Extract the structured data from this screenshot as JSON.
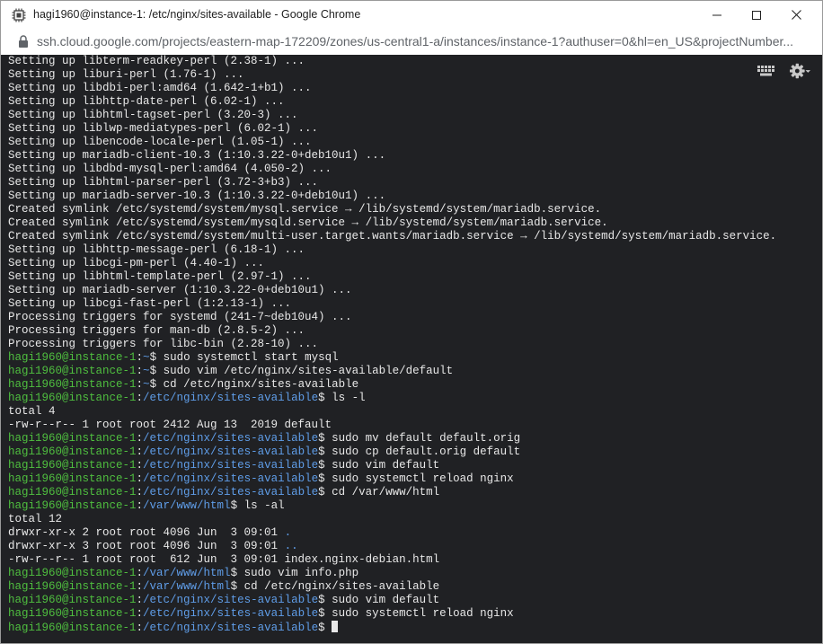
{
  "window": {
    "title": "hagi1960@instance-1: /etc/nginx/sites-available - Google Chrome",
    "url": "ssh.cloud.google.com/projects/eastern-map-172209/zones/us-central1-a/instances/instance-1?authuser=0&hl=en_US&projectNumber..."
  },
  "colors": {
    "terminal_bg": "#202124",
    "prompt_user": "#4fbf3f",
    "prompt_path": "#5f9de8",
    "text": "#e8e8e8"
  },
  "toolbar": {
    "icons": [
      "keyboard-icon",
      "settings-gear-icon"
    ]
  },
  "terminal": {
    "lines": [
      {
        "text": "Setting up libterm-readkey-perl (2.38-1) ..."
      },
      {
        "text": "Setting up liburi-perl (1.76-1) ..."
      },
      {
        "text": "Setting up libdbi-perl:amd64 (1.642-1+b1) ..."
      },
      {
        "text": "Setting up libhttp-date-perl (6.02-1) ..."
      },
      {
        "text": "Setting up libhtml-tagset-perl (3.20-3) ..."
      },
      {
        "text": "Setting up liblwp-mediatypes-perl (6.02-1) ..."
      },
      {
        "text": "Setting up libencode-locale-perl (1.05-1) ..."
      },
      {
        "text": "Setting up mariadb-client-10.3 (1:10.3.22-0+deb10u1) ..."
      },
      {
        "text": "Setting up libdbd-mysql-perl:amd64 (4.050-2) ..."
      },
      {
        "text": "Setting up libhtml-parser-perl (3.72-3+b3) ..."
      },
      {
        "text": "Setting up mariadb-server-10.3 (1:10.3.22-0+deb10u1) ..."
      },
      {
        "text": "Created symlink /etc/systemd/system/mysql.service → /lib/systemd/system/mariadb.service."
      },
      {
        "text": "Created symlink /etc/systemd/system/mysqld.service → /lib/systemd/system/mariadb.service."
      },
      {
        "text": "Created symlink /etc/systemd/system/multi-user.target.wants/mariadb.service → /lib/systemd/system/mariadb.service."
      },
      {
        "text": "Setting up libhttp-message-perl (6.18-1) ..."
      },
      {
        "text": "Setting up libcgi-pm-perl (4.40-1) ..."
      },
      {
        "text": "Setting up libhtml-template-perl (2.97-1) ..."
      },
      {
        "text": "Setting up mariadb-server (1:10.3.22-0+deb10u1) ..."
      },
      {
        "text": "Setting up libcgi-fast-perl (1:2.13-1) ..."
      },
      {
        "text": "Processing triggers for systemd (241-7~deb10u4) ..."
      },
      {
        "text": "Processing triggers for man-db (2.8.5-2) ..."
      },
      {
        "text": "Processing triggers for libc-bin (2.28-10) ..."
      },
      {
        "user": "hagi1960@instance-1",
        "path": "~",
        "cmd": " sudo systemctl start mysql"
      },
      {
        "user": "hagi1960@instance-1",
        "path": "~",
        "cmd": " sudo vim /etc/nginx/sites-available/default"
      },
      {
        "user": "hagi1960@instance-1",
        "path": "~",
        "cmd": " cd /etc/nginx/sites-available"
      },
      {
        "user": "hagi1960@instance-1",
        "path": "/etc/nginx/sites-available",
        "cmd": " ls -l"
      },
      {
        "text": "total 4"
      },
      {
        "text": "-rw-r--r-- 1 root root 2412 Aug 13  2019 default"
      },
      {
        "user": "hagi1960@instance-1",
        "path": "/etc/nginx/sites-available",
        "cmd": " sudo mv default default.orig"
      },
      {
        "user": "hagi1960@instance-1",
        "path": "/etc/nginx/sites-available",
        "cmd": " sudo cp default.orig default"
      },
      {
        "user": "hagi1960@instance-1",
        "path": "/etc/nginx/sites-available",
        "cmd": " sudo vim default"
      },
      {
        "user": "hagi1960@instance-1",
        "path": "/etc/nginx/sites-available",
        "cmd": " sudo systemctl reload nginx"
      },
      {
        "user": "hagi1960@instance-1",
        "path": "/etc/nginx/sites-available",
        "cmd": " cd /var/www/html"
      },
      {
        "user": "hagi1960@instance-1",
        "path": "/var/www/html",
        "cmd": " ls -al"
      },
      {
        "text": "total 12"
      },
      {
        "text": "drwxr-xr-x 2 root root 4096 Jun  3 09:01 ",
        "dir": "."
      },
      {
        "text": "drwxr-xr-x 3 root root 4096 Jun  3 09:01 ",
        "dir": ".."
      },
      {
        "text": "-rw-r--r-- 1 root root  612 Jun  3 09:01 index.nginx-debian.html"
      },
      {
        "user": "hagi1960@instance-1",
        "path": "/var/www/html",
        "cmd": " sudo vim info.php"
      },
      {
        "user": "hagi1960@instance-1",
        "path": "/var/www/html",
        "cmd": " cd /etc/nginx/sites-available"
      },
      {
        "user": "hagi1960@instance-1",
        "path": "/etc/nginx/sites-available",
        "cmd": " sudo vim default"
      },
      {
        "user": "hagi1960@instance-1",
        "path": "/etc/nginx/sites-available",
        "cmd": " sudo systemctl reload nginx"
      },
      {
        "user": "hagi1960@instance-1",
        "path": "/etc/nginx/sites-available",
        "cmd": " ",
        "cursor": true
      }
    ]
  }
}
